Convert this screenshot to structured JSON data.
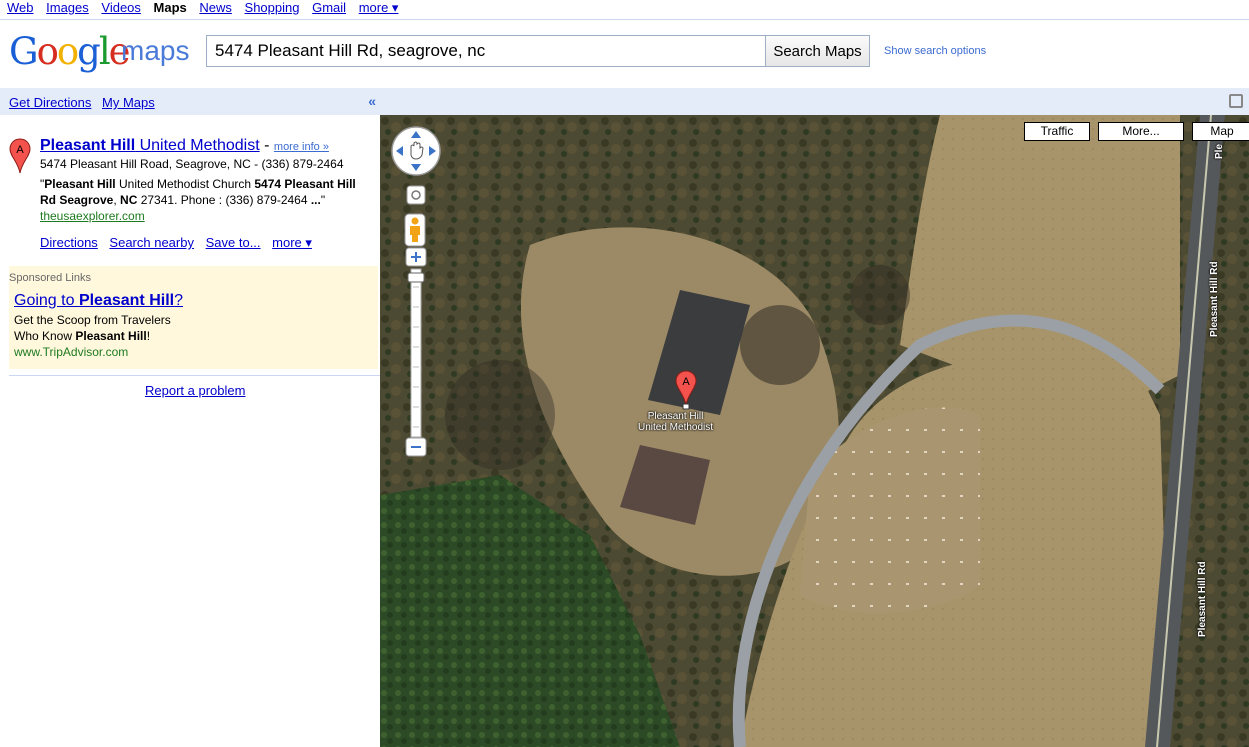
{
  "topnav": {
    "items": [
      "Web",
      "Images",
      "Videos",
      "Maps",
      "News",
      "Shopping",
      "Gmail",
      "more ▾"
    ],
    "current": "Maps"
  },
  "header": {
    "logo_text": "Google",
    "logo_suffix": "maps",
    "search_value": "5474 Pleasant Hill Rd, seagrove, nc",
    "search_button": "Search Maps",
    "options_link": "Show search options"
  },
  "leftbar": {
    "get_directions": "Get Directions",
    "my_maps": "My Maps",
    "collapse_icon": "«"
  },
  "result": {
    "marker_letter": "A",
    "title_bold": "Pleasant Hill",
    "title_rest": " United Methodist",
    "more_info": "more info »",
    "address": "5474 Pleasant Hill Road, Seagrove, NC - (336) 879-2464",
    "snippet_q1": "\"",
    "snippet_b1": "Pleasant Hill",
    "snippet_t1": " United Methodist Church ",
    "snippet_b2": "5474 Pleasant Hill Rd Seagrove",
    "snippet_t2": ", ",
    "snippet_b3": "NC",
    "snippet_t3": " 27341. Phone : (336) 879-2464 ",
    "snippet_b4": "...",
    "snippet_q2": "\" ",
    "snippet_source": "theusaexplorer.com",
    "actions": [
      "Directions",
      "Search nearby",
      "Save to...",
      "more ▾"
    ]
  },
  "sponsored": {
    "label": "Sponsored Links",
    "ad_title_pre": "Going to ",
    "ad_title_bold": "Pleasant Hill",
    "ad_title_post": "?",
    "line1": "Get the Scoop from Travelers",
    "line2_pre": "Who Know ",
    "line2_bold": "Pleasant Hill",
    "line2_post": "!",
    "url": "www.TripAdvisor.com"
  },
  "report_link": "Report a problem",
  "map": {
    "buttons": [
      "Traffic",
      "More...",
      "Map"
    ],
    "marker_letter": "A",
    "marker_label_line1": "Pleasant Hill",
    "marker_label_line2": "United Methodist",
    "road_labels": [
      "Pleasant Hill Rd",
      "Pleasant Hill Rd",
      "Ple"
    ],
    "icons": [
      "pan-control-icon",
      "hand-icon",
      "home-icon",
      "pegman-icon",
      "zoom-in-icon",
      "zoom-out-icon",
      "print-icon"
    ]
  }
}
